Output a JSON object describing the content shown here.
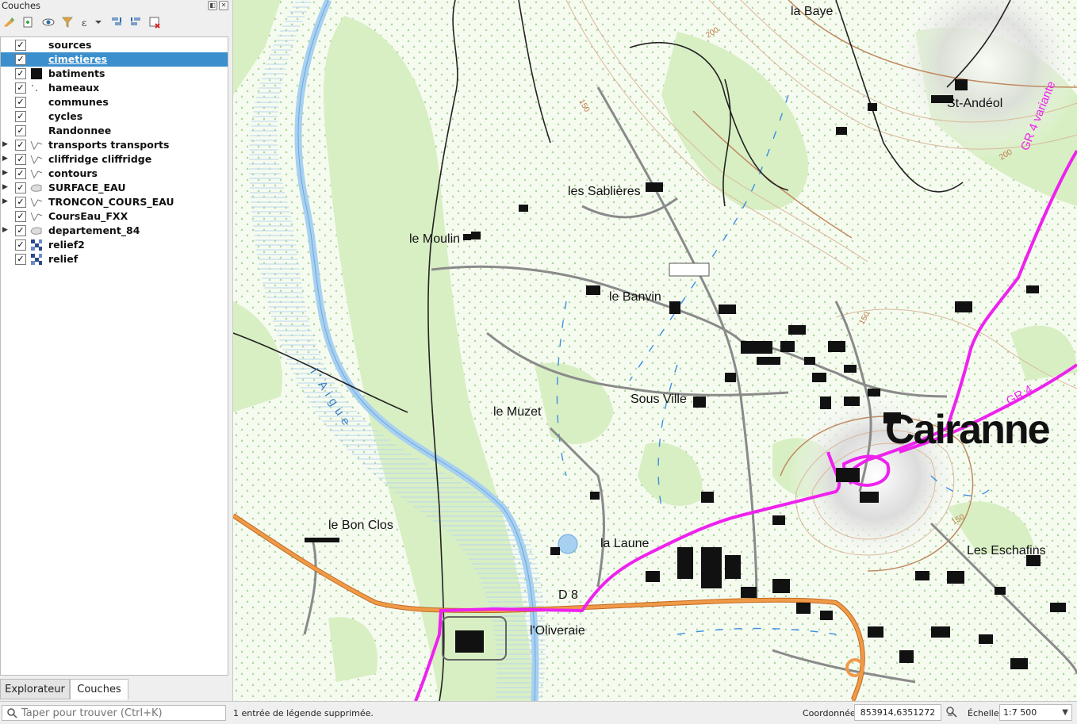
{
  "panel": {
    "title": "Couches",
    "layers": [
      {
        "name": "sources",
        "checked": true,
        "expandable": false,
        "symbol": "none"
      },
      {
        "name": "cimetieres",
        "checked": true,
        "expandable": false,
        "symbol": "none",
        "selected": true
      },
      {
        "name": "batiments",
        "checked": true,
        "expandable": false,
        "symbol": "black-fill"
      },
      {
        "name": "hameaux",
        "checked": true,
        "expandable": false,
        "symbol": "point"
      },
      {
        "name": "communes",
        "checked": true,
        "expandable": false,
        "symbol": "none"
      },
      {
        "name": "cycles",
        "checked": true,
        "expandable": false,
        "symbol": "none"
      },
      {
        "name": "Randonnee",
        "checked": true,
        "expandable": false,
        "symbol": "none"
      },
      {
        "name": "transports transports",
        "checked": true,
        "expandable": true,
        "symbol": "line"
      },
      {
        "name": "cliffridge cliffridge",
        "checked": true,
        "expandable": true,
        "symbol": "line"
      },
      {
        "name": "contours",
        "checked": true,
        "expandable": true,
        "symbol": "line"
      },
      {
        "name": "SURFACE_EAU",
        "checked": true,
        "expandable": true,
        "symbol": "polygon"
      },
      {
        "name": "TRONCON_COURS_EAU",
        "checked": true,
        "expandable": true,
        "symbol": "line"
      },
      {
        "name": "CoursEau_FXX",
        "checked": true,
        "expandable": false,
        "symbol": "line"
      },
      {
        "name": "departement_84",
        "checked": true,
        "expandable": true,
        "symbol": "polygon"
      },
      {
        "name": "relief2",
        "checked": true,
        "expandable": false,
        "symbol": "raster"
      },
      {
        "name": "relief",
        "checked": true,
        "expandable": false,
        "symbol": "raster"
      }
    ],
    "tabs": [
      "Explorateur",
      "Couches"
    ]
  },
  "search": {
    "placeholder": "Taper pour trouver (Ctrl+K)"
  },
  "status": {
    "message": "1 entrée de légende supprimée.",
    "coord_label": "Coordonnée",
    "coord_value": "853914,6351272",
    "scale_label": "Échelle",
    "scale_value": "1:7 500"
  },
  "map": {
    "places": {
      "la_baye": "la Baye",
      "st_andeol": "St-Andéol",
      "les_sablieres": "les Sablières",
      "le_moulin": "le Moulin",
      "le_banvin": "le Banvin",
      "sous_ville": "Sous Ville",
      "le_muzet": "le Muzet",
      "cairanne": "Cairanne",
      "le_bon_clos": "le Bon Clos",
      "la_laune": "la Laune",
      "les_eschafins": "Les Eschafins",
      "d8": "D 8",
      "oliveraie": "l'Oliveraie"
    },
    "routes": {
      "gr4_variante": "GR 4 variante",
      "gr4": "GR 4"
    },
    "river": "l'Aigue",
    "contours": {
      "c200a": "200",
      "c150a": "150",
      "c200b": "200",
      "c150b": "150",
      "c150c": "150"
    },
    "colors": {
      "trail": "#ee22ee",
      "road": "#f09a48",
      "water": "#a8d0f0",
      "vegetation": "#d8efc4",
      "contour": "#c07a4a"
    }
  }
}
